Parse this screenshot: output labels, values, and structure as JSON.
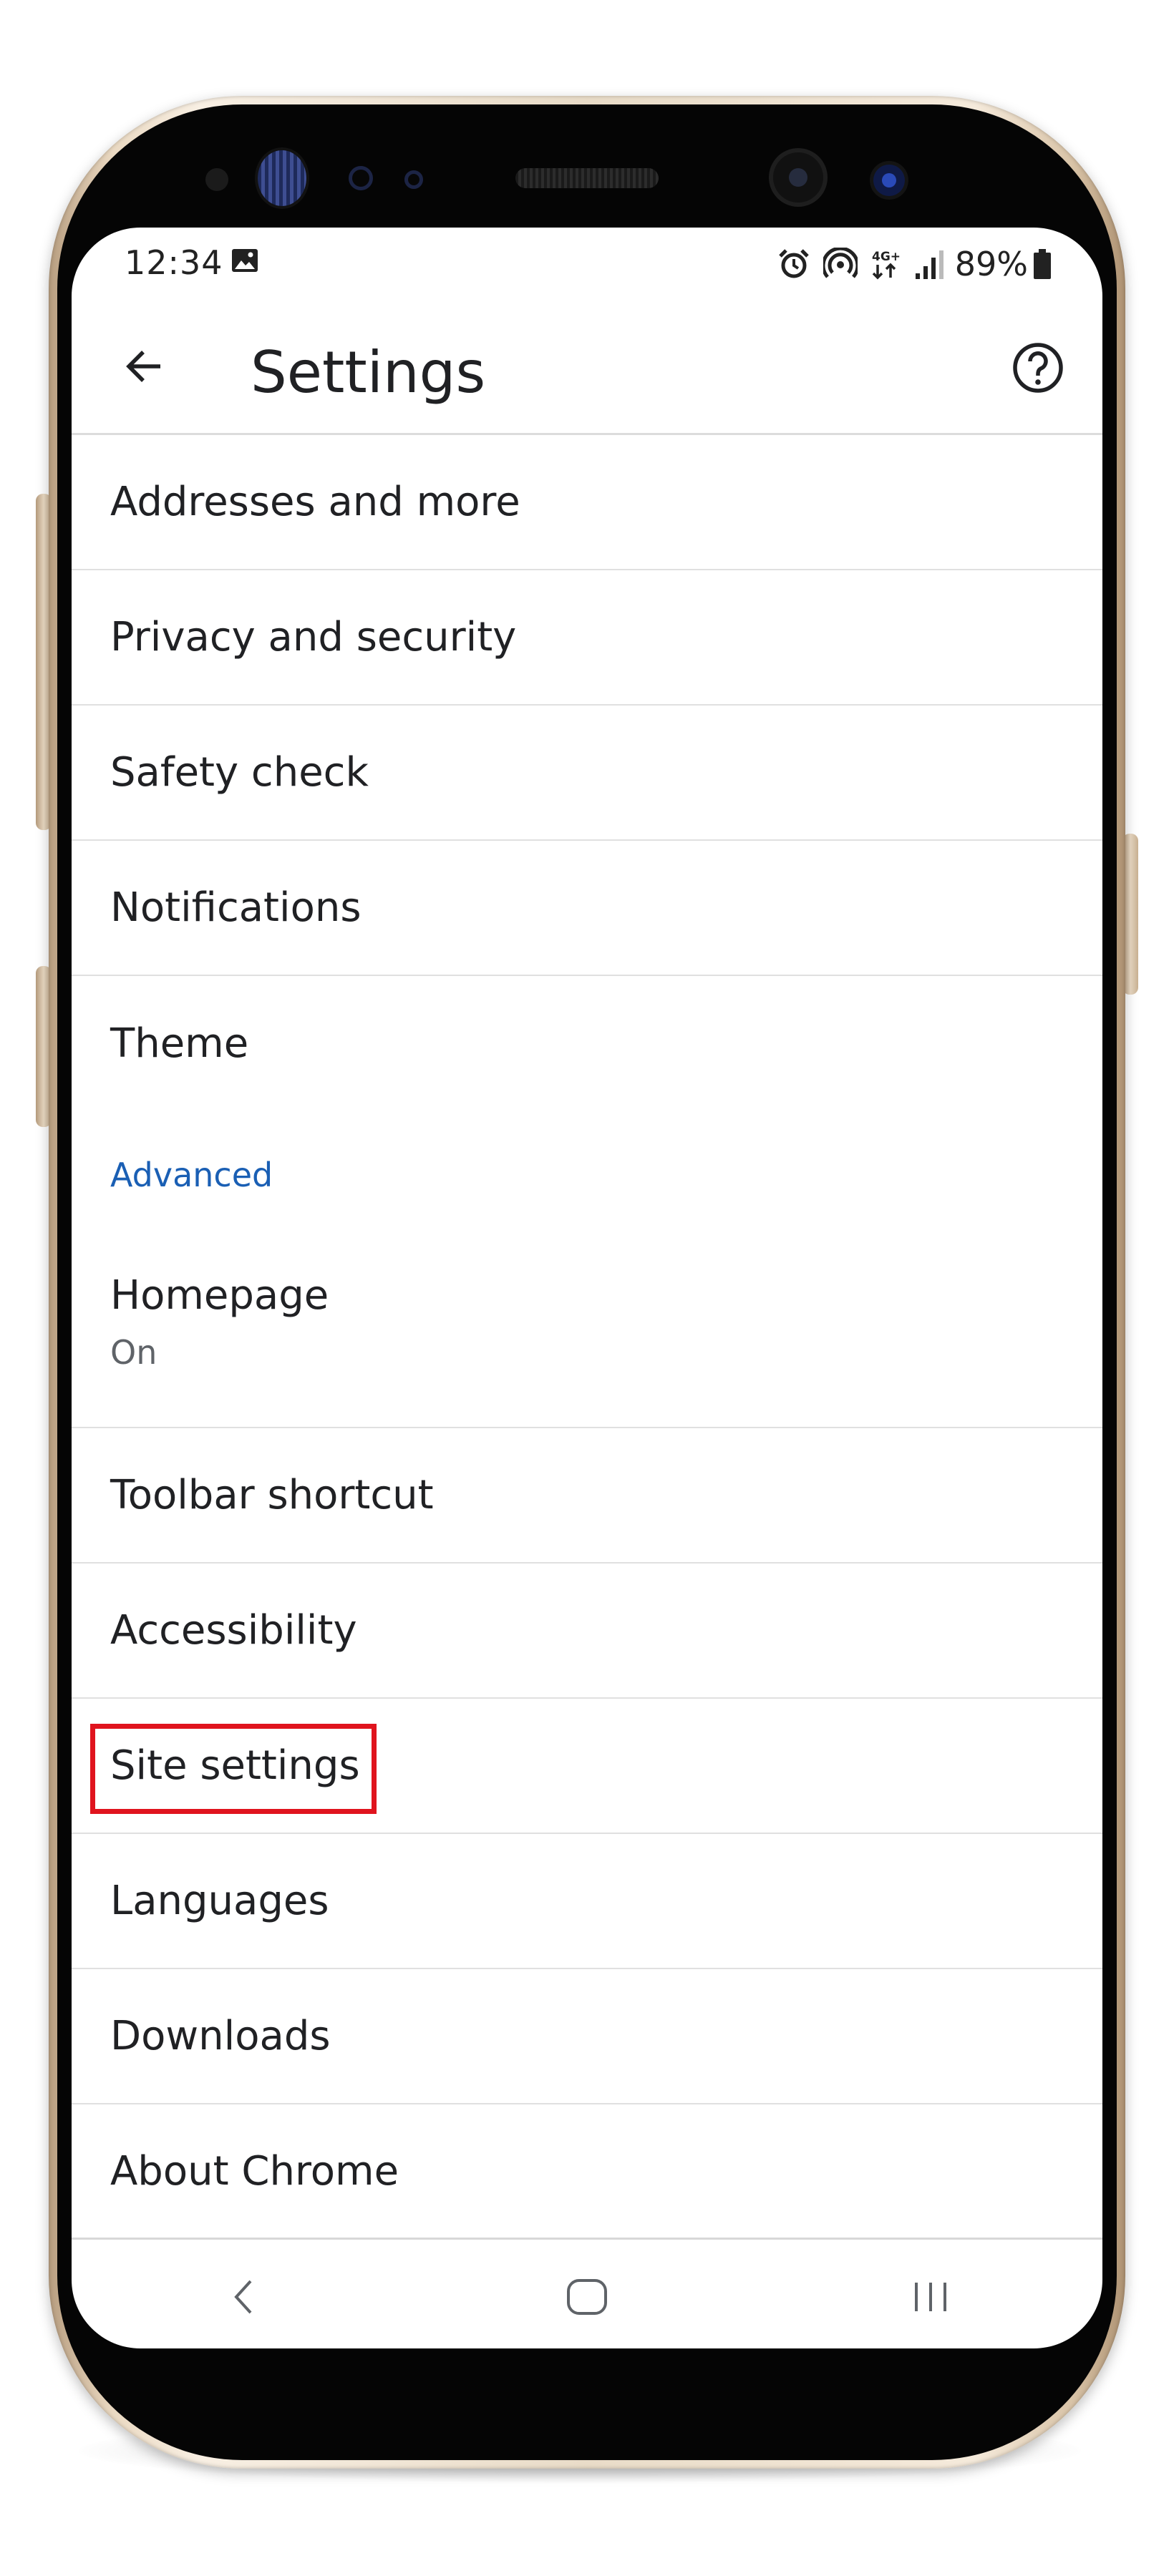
{
  "status_bar": {
    "time": "12:34",
    "battery": "89%",
    "network_label": "4G+",
    "icons": [
      "image-icon",
      "alarm-icon",
      "hotspot-icon",
      "data-icon",
      "signal-icon",
      "battery-icon"
    ]
  },
  "app_bar": {
    "title": "Settings",
    "back_icon": "arrow-back-icon",
    "help_icon": "help-circle-icon"
  },
  "settings": {
    "items": [
      {
        "label": "Addresses and more"
      },
      {
        "label": "Privacy and security"
      },
      {
        "label": "Safety check"
      },
      {
        "label": "Notifications"
      },
      {
        "label": "Theme"
      }
    ],
    "advanced_header": "Advanced",
    "homepage": {
      "label": "Homepage",
      "value": "On"
    },
    "advanced_items": [
      {
        "label": "Toolbar shortcut"
      },
      {
        "label": "Accessibility"
      },
      {
        "label": "Site settings",
        "highlighted": true
      },
      {
        "label": "Languages"
      },
      {
        "label": "Downloads"
      },
      {
        "label": "About Chrome"
      }
    ]
  },
  "nav_bar": {
    "icons": [
      "back-chevron-icon",
      "home-icon",
      "recents-icon"
    ]
  },
  "colors": {
    "accent_blue": "#1a5fb4",
    "highlight_red": "#e0141e",
    "text_primary": "#202124",
    "divider": "#e0e0e0"
  }
}
